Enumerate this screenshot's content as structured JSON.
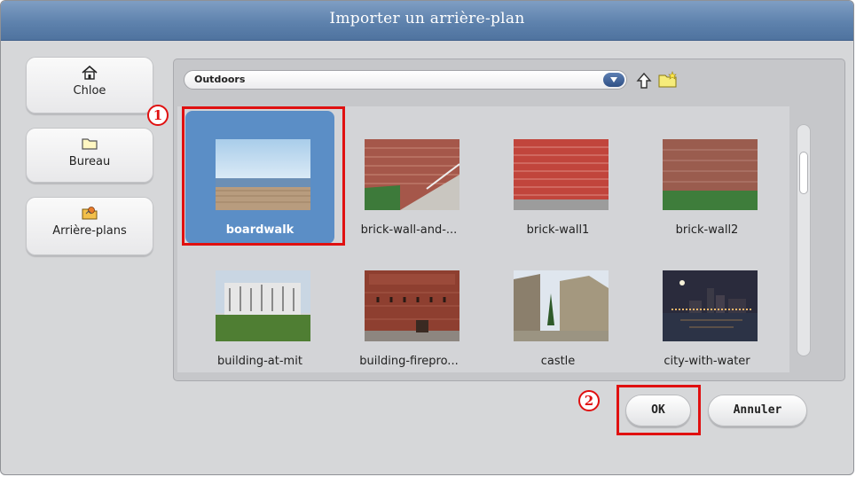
{
  "window": {
    "title": "Importer un arrière-plan"
  },
  "sidebar": {
    "items": [
      {
        "label": "Chloe",
        "icon": "home-icon"
      },
      {
        "label": "Bureau",
        "icon": "folder-icon"
      },
      {
        "label": "Arrière-plans",
        "icon": "backgrounds-icon"
      }
    ]
  },
  "browser": {
    "folder": "Outdoors",
    "tiles": [
      {
        "label": "boardwalk",
        "selected": true
      },
      {
        "label": "brick-wall-and-..."
      },
      {
        "label": "brick-wall1"
      },
      {
        "label": "brick-wall2"
      },
      {
        "label": "building-at-mit"
      },
      {
        "label": "building-firepro..."
      },
      {
        "label": "castle"
      },
      {
        "label": "city-with-water"
      }
    ]
  },
  "buttons": {
    "ok": "OK",
    "cancel": "Annuler"
  },
  "annotations": {
    "one": "1",
    "two": "2"
  },
  "colors": {
    "selection": "#5b8ec6",
    "annotation": "#e01010",
    "title_bar": "#5e82ad"
  }
}
